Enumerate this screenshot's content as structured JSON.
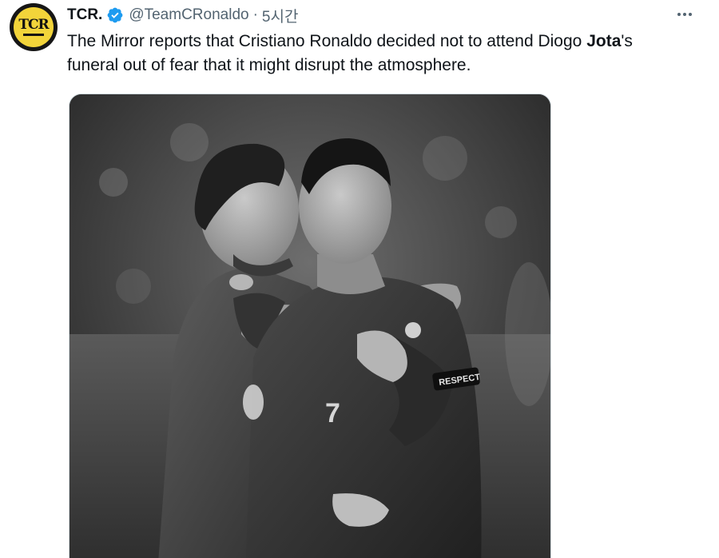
{
  "tweet": {
    "author": {
      "display_name": "TCR.",
      "handle": "@TeamCRonaldo",
      "verified": true,
      "avatar_text": "TCR",
      "avatar_color": "#f2d43a"
    },
    "separator": "·",
    "time": "5시간",
    "text": {
      "part1": "The Mirror reports that Cristiano Ronaldo decided not to attend Diogo ",
      "bold": "Jota",
      "part2": "'s funeral out of fear that it might disrupt the atmosphere."
    },
    "more_icon": "more-horizontal-icon",
    "verified_icon": "verified-badge-icon",
    "verified_color": "#1d9bf0",
    "media": {
      "type": "black-and-white photo",
      "shirt_number": "7",
      "armband_text": "RESPECT"
    }
  }
}
